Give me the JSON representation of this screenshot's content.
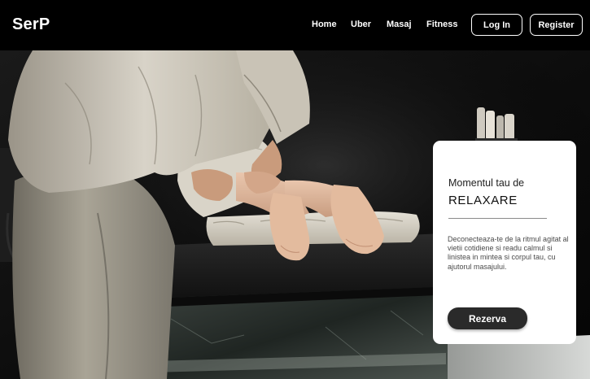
{
  "brand": {
    "logo_text": "SerP"
  },
  "nav": {
    "links": [
      {
        "label": "Home"
      },
      {
        "label": "Uber"
      },
      {
        "label": "Masaj"
      },
      {
        "label": "Fitness"
      }
    ],
    "login_label": "Log In",
    "register_label": "Register"
  },
  "hero_card": {
    "kicker": "Momentul tau de",
    "title": "RELAXARE",
    "description": "Deconecteaza-te de la ritmul agitat al vietii cotidiene si readu calmul si linistea in mintea si corpul tau, cu ajutorul masajului.",
    "cta_label": "Rezerva"
  },
  "colors": {
    "nav_background": "#000000",
    "card_background": "#ffffff",
    "cta_background": "#2a2a2a",
    "text_light": "#ffffff"
  }
}
